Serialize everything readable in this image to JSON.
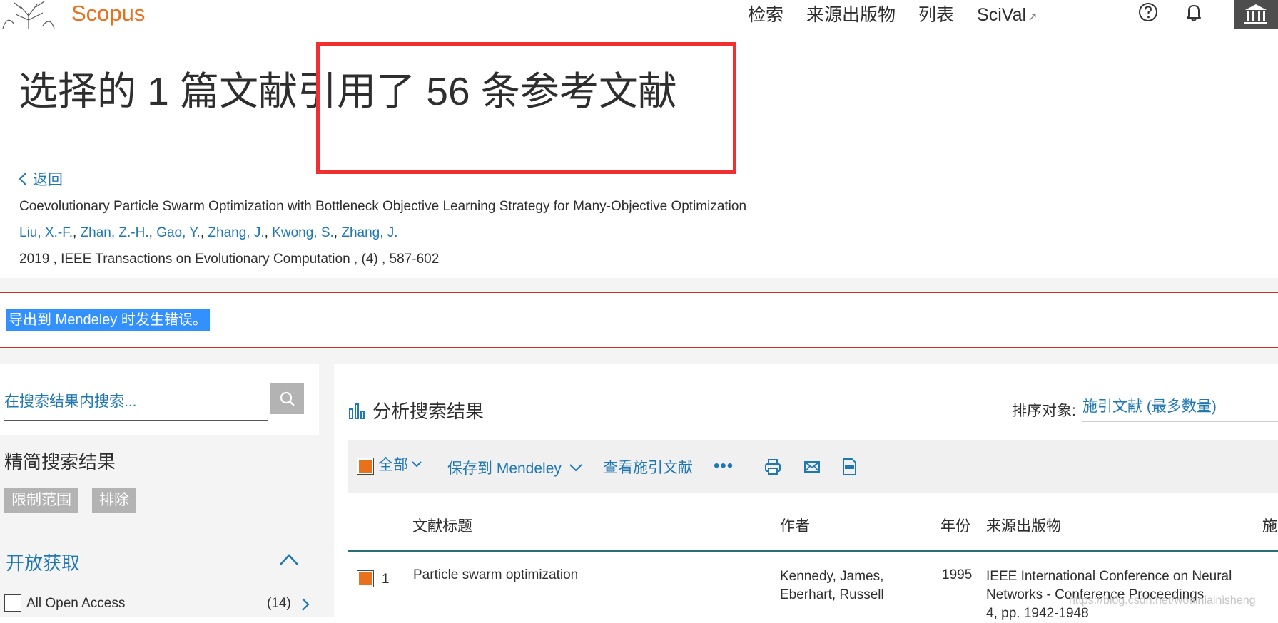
{
  "header": {
    "brand": "Scopus",
    "nav": [
      {
        "label": "检索"
      },
      {
        "label": "来源出版物"
      },
      {
        "label": "列表"
      },
      {
        "label": "SciVal",
        "ext": "↗"
      }
    ]
  },
  "page": {
    "title": "选择的 1 篇文献引用了 56 条参考文献",
    "back_label": "返回",
    "document": {
      "title": "Coevolutionary Particle Swarm Optimization with Bottleneck Objective Learning Strategy for Many-Objective Optimization",
      "authors": [
        "Liu, X.-F.",
        "Zhan, Z.-H.",
        "Gao, Y.",
        "Zhang, J.",
        "Kwong, S.",
        "Zhang, J."
      ],
      "pubinfo": "2019 , IEEE Transactions on Evolutionary Computation , (4) , 587-602"
    }
  },
  "error": {
    "message": "导出到 Mendeley 时发生错误。"
  },
  "sidebar": {
    "search_placeholder": "在搜索结果内搜索...",
    "refine_title": "精简搜索结果",
    "limit_label": "限制范围",
    "exclude_label": "排除",
    "open_access": {
      "title": "开放获取",
      "items": [
        {
          "label": "All Open Access",
          "count": "(14)"
        }
      ]
    }
  },
  "results": {
    "analyze_label": "分析搜索结果",
    "sort_label": "排序对象:",
    "sort_value": "施引文献 (最多数量)",
    "toolbar": {
      "all_label": "全部",
      "save_label": "保存到 Mendeley",
      "cited_label": "查看施引文献",
      "more_label": "•••"
    },
    "columns": {
      "title": "文献标题",
      "authors": "作者",
      "year": "年份",
      "source": "来源出版物",
      "cited": "施"
    },
    "rows": [
      {
        "num": "1",
        "title": "Particle swarm optimization",
        "authors_line1": "Kennedy, James,",
        "authors_line2": "Eberhart, Russell",
        "year": "1995",
        "source_line1": "IEEE International Conference on Neural",
        "source_line2": "Networks - Conference Proceedings",
        "source_line3": "4, pp. 1942-1948"
      }
    ]
  },
  "watermark": "https://blog.csdn.net/woainiainisheng",
  "colors": {
    "brand": "#e9711c",
    "link": "#1f77b4",
    "error_border": "#c7302c",
    "highlight": "#3390ff",
    "annotation_box": "#f03030"
  }
}
